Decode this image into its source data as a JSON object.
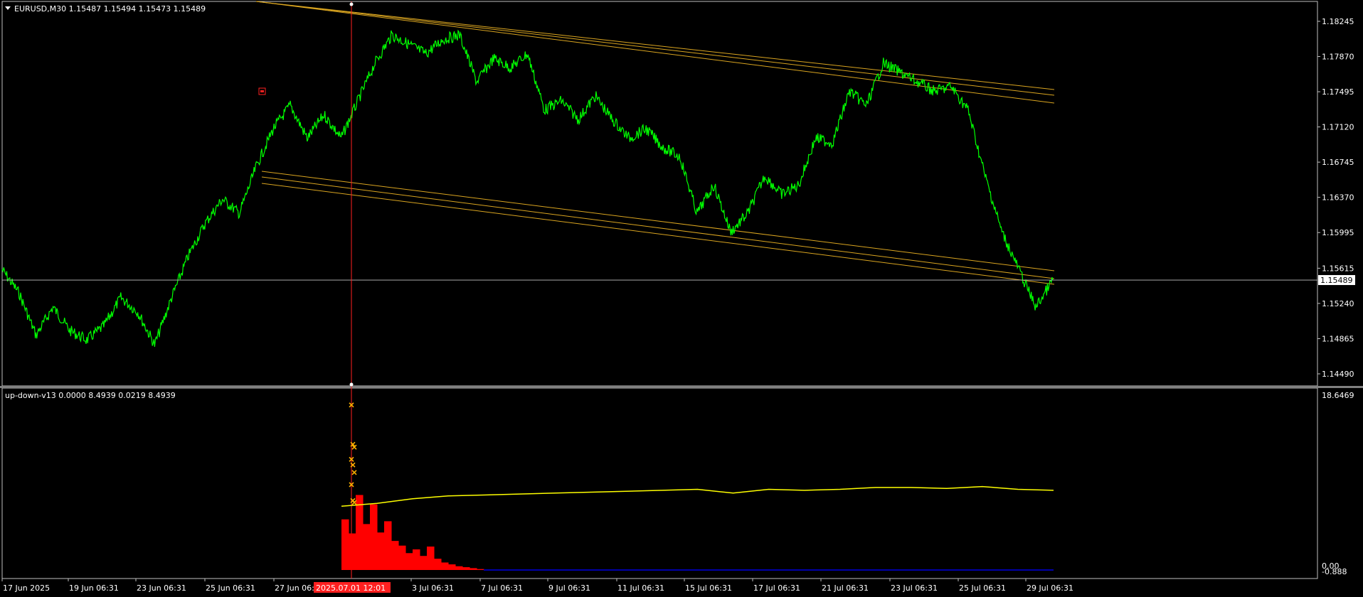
{
  "colors": {
    "background": "#000000",
    "price_line": "#00ff00",
    "channel": "#daa520",
    "marker_line": "#ff2020",
    "hist_red": "#ff0000",
    "ma_yellow": "#ffff00",
    "hist_blue": "#0000aa",
    "bid_line": "#c0c0c0",
    "axis_text": "#ffffff"
  },
  "header": {
    "symbol_info": "EURUSD,M30  1.15487 1.15494 1.15473 1.15489",
    "indicator_info": "up-down-v13 0.0000 8.4939 0.0219 8.4939"
  },
  "chart_data": [
    {
      "type": "line",
      "name": "price",
      "ylim": [
        1.1449,
        1.18245
      ],
      "y_ticks": [
        "1.18245",
        "1.17870",
        "1.17495",
        "1.17120",
        "1.16745",
        "1.16370",
        "1.15995",
        "1.15615",
        "1.15240",
        "1.14865",
        "1.14490"
      ],
      "current_price": "1.15489",
      "x": [
        0,
        0.5,
        1.0,
        1.5,
        2.0,
        2.5,
        3.0,
        3.5,
        4.0,
        4.5,
        5.0,
        5.5,
        6.0,
        6.5,
        7.0,
        7.5,
        8.0,
        8.5,
        9.0,
        9.5,
        10.0,
        10.5,
        11.0,
        11.5,
        12.0,
        12.5,
        13.0,
        13.5,
        14.0,
        14.5,
        15.0,
        15.5,
        16.0,
        16.5,
        17.0,
        17.5,
        18.0,
        18.5,
        19.0,
        19.5,
        20.0,
        20.5,
        21.0,
        21.5,
        22.0,
        22.5,
        23.0,
        23.5,
        24.0,
        24.5,
        25.0,
        25.5,
        26.0,
        26.5,
        27.0,
        27.5,
        28.0,
        28.5,
        29.0,
        29.5,
        30.0,
        30.5,
        31.0
      ],
      "values": [
        1.156,
        1.1535,
        1.149,
        1.152,
        1.1495,
        1.1485,
        1.15,
        1.153,
        1.1515,
        1.148,
        1.153,
        1.1575,
        1.161,
        1.1635,
        1.162,
        1.167,
        1.171,
        1.1735,
        1.17,
        1.1725,
        1.17,
        1.174,
        1.178,
        1.181,
        1.18,
        1.179,
        1.1805,
        1.181,
        1.176,
        1.1785,
        1.1775,
        1.179,
        1.173,
        1.174,
        1.172,
        1.1745,
        1.172,
        1.17,
        1.171,
        1.169,
        1.168,
        1.162,
        1.165,
        1.16,
        1.162,
        1.166,
        1.164,
        1.165,
        1.17,
        1.1695,
        1.175,
        1.1735,
        1.178,
        1.177,
        1.176,
        1.175,
        1.1755,
        1.173,
        1.166,
        1.16,
        1.156,
        1.152,
        1.1549
      ],
      "x_ticks": [
        "17 Jun 2025",
        "19 Jun 06:31",
        "23 Jun 06:31",
        "25 Jun 06:31",
        "27 Jun 06:",
        "3 Jul 06:31",
        "7 Jul 06:31",
        "9 Jul 06:31",
        "11 Jul 06:31",
        "15 Jul 06:31",
        "17 Jul 06:31",
        "21 Jul 06:31",
        "23 Jul 06:31",
        "25 Jul 06:31",
        "29 Jul 06:31"
      ],
      "selected_time": "2025.07.01 12:01"
    },
    {
      "type": "bar",
      "name": "up-down-v13",
      "ylim": [
        0.0,
        18.6469
      ],
      "y_ticks": [
        "18.6469",
        "0.00",
        "-0.888"
      ],
      "x": [
        0,
        0.5,
        1.0,
        1.5,
        2.0,
        2.5,
        3.0,
        3.5,
        4.0,
        4.5,
        5.0,
        5.5,
        6.0,
        6.5,
        7.0,
        7.5,
        8.0,
        8.5,
        9.0,
        9.5,
        10.0
      ],
      "values": [
        5.4,
        3.9,
        8.0,
        4.9,
        7.0,
        4.0,
        5.2,
        3.1,
        2.6,
        1.8,
        2.2,
        1.5,
        2.5,
        1.2,
        0.8,
        0.6,
        0.4,
        0.3,
        0.2,
        0.1,
        0.05
      ],
      "signal_line": {
        "x": [
          0,
          5,
          10,
          15,
          20,
          25,
          30,
          35,
          40,
          45,
          50,
          55,
          60,
          65,
          70,
          75,
          80,
          85,
          90,
          95,
          100
        ],
        "values": [
          6.8,
          7.1,
          7.6,
          7.9,
          8.0,
          8.1,
          8.2,
          8.3,
          8.4,
          8.5,
          8.6,
          8.2,
          8.6,
          8.5,
          8.6,
          8.8,
          8.8,
          8.7,
          8.9,
          8.6,
          8.5
        ]
      },
      "spike_markers": [
        17.6,
        13.4,
        13.1,
        11.8,
        11.2,
        10.4,
        9.1,
        7.4,
        7.2
      ]
    }
  ]
}
